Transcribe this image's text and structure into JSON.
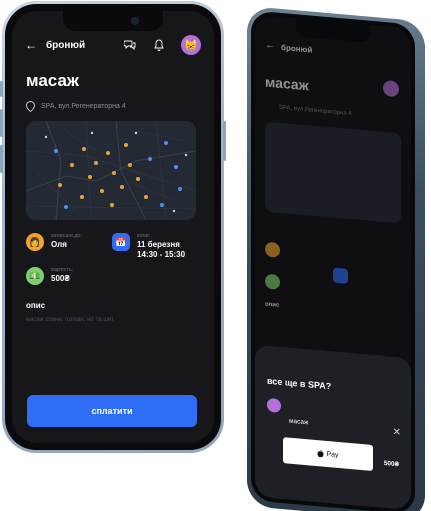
{
  "header": {
    "back_icon": "arrow-left-icon",
    "title": "бронюй",
    "chat_icon": "chat-bubbles-icon",
    "bell_icon": "bell-icon"
  },
  "service": {
    "title": "масаж",
    "address": "SPA, вул.Регенераторна 4"
  },
  "booking": {
    "master_label": "записані до:",
    "master_name": "Оля",
    "date_label": "коли:",
    "date_value": "11 березня",
    "time_value": "14:30 - 15:30",
    "price_label": "вартість:",
    "price_value": "500₴"
  },
  "description": {
    "heading": "опис",
    "text": "масаж спини, голови, ніг та шиї"
  },
  "pay_button": "сплатити",
  "sheet": {
    "heading": "все ще в SPA?",
    "item": "масаж",
    "price": "500₴",
    "pay_label": "Pay",
    "close_icon": "close-icon"
  },
  "colors": {
    "accent": "#2f6df5",
    "screen_bg": "#17171b",
    "avatar_purple": "#b56fd8",
    "marker_orange": "#e9a23b",
    "marker_blue": "#4f8ef7"
  }
}
